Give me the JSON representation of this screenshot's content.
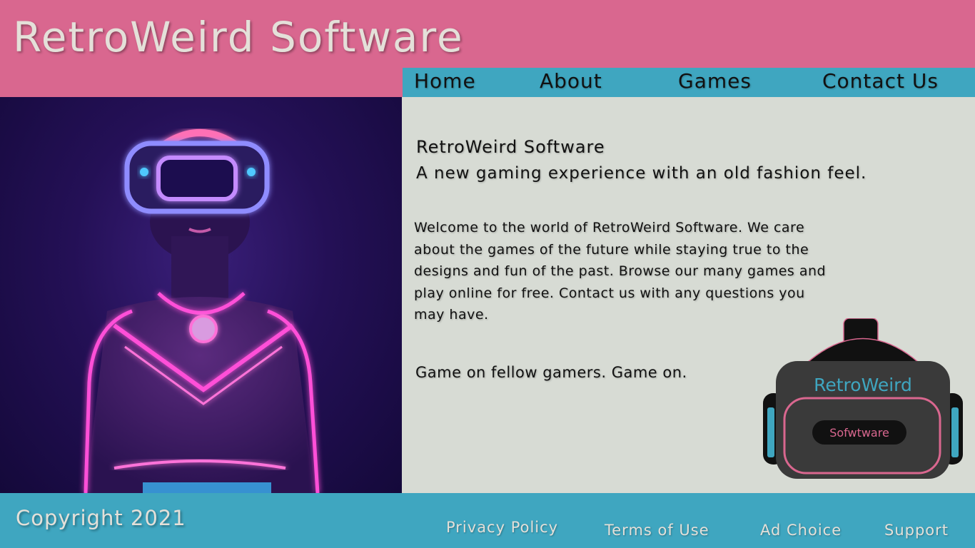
{
  "header": {
    "title": "RetroWeird Software"
  },
  "nav": {
    "home": "Home",
    "about": "About",
    "games": "Games",
    "contact": "Contact Us"
  },
  "main": {
    "title": "RetroWeird Software",
    "subtitle": "A new gaming experience with an old fashion feel.",
    "welcome_lines": [
      "Welcome to the world of RetroWeird Software. We care",
      "about the games of the future while staying true to the",
      "designs and fun of the past. Browse our many games and",
      "play online for free. Contact us with any questions you",
      "may have."
    ],
    "closing": "Game on fellow gamers. Game on."
  },
  "logo": {
    "brand": "RetroWeird",
    "sub": "Sofwtware"
  },
  "footer": {
    "copyright": "Copyright 2021",
    "links": {
      "privacy": "Privacy Policy",
      "terms": "Terms of Use",
      "adchoice": "Ad Choice",
      "support": "Support"
    }
  },
  "colors": {
    "header_bg": "#d9678f",
    "nav_bg": "#3fa6c0",
    "content_bg": "#d7dbd4",
    "neon_pink": "#ff4fd8",
    "neon_blue": "#6f7bff"
  }
}
